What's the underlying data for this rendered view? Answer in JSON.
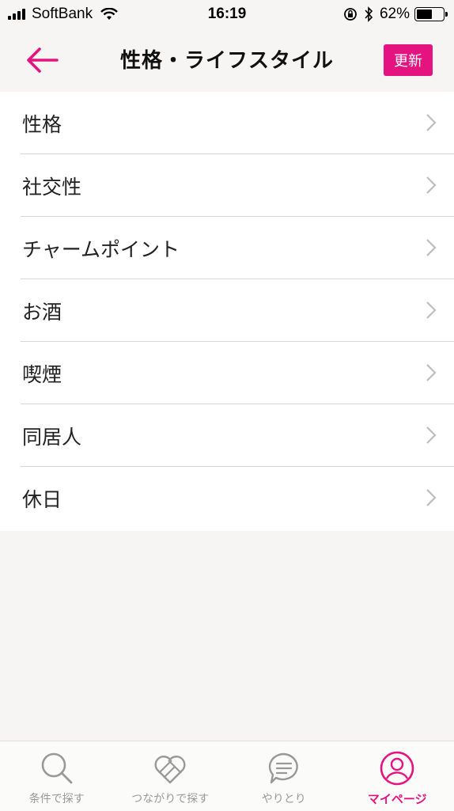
{
  "status_bar": {
    "carrier": "SoftBank",
    "time": "16:19",
    "battery_percent": "62%",
    "battery_level": 0.62
  },
  "header": {
    "title": "性格・ライフスタイル",
    "update_label": "更新"
  },
  "menu": {
    "items": [
      {
        "label": "性格"
      },
      {
        "label": "社交性"
      },
      {
        "label": "チャームポイント"
      },
      {
        "label": "お酒"
      },
      {
        "label": "喫煙"
      },
      {
        "label": "同居人"
      },
      {
        "label": "休日"
      }
    ]
  },
  "tabs": [
    {
      "label": "条件で探す",
      "icon": "search-icon",
      "active": false
    },
    {
      "label": "つながりで探す",
      "icon": "heart-connection-icon",
      "active": false
    },
    {
      "label": "やりとり",
      "icon": "chat-bubble-icon",
      "active": false
    },
    {
      "label": "マイページ",
      "icon": "profile-icon",
      "active": true
    }
  ],
  "colors": {
    "accent": "#e5137f",
    "background": "#f6f5f3",
    "inactive": "#999999"
  }
}
